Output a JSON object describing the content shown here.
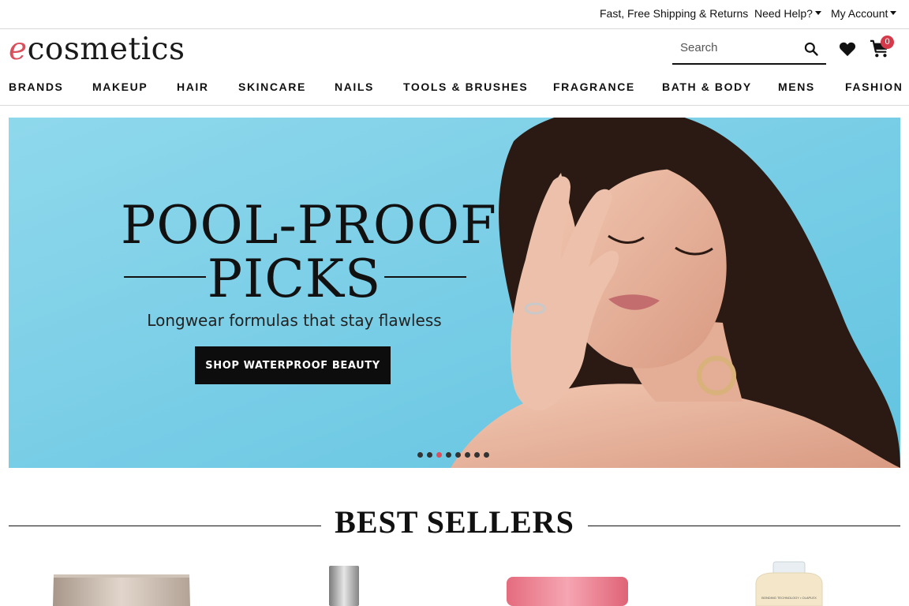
{
  "utility": {
    "shipping": "Fast, Free Shipping & Returns",
    "help": "Need Help?",
    "account": "My Account"
  },
  "header": {
    "logo_first": "e",
    "logo_rest": "cosmetics",
    "search_placeholder": "Search",
    "cart_count": "0"
  },
  "nav": {
    "items": [
      "BRANDS",
      "MAKEUP",
      "HAIR",
      "SKINCARE",
      "NAILS",
      "TOOLS & BRUSHES",
      "FRAGRANCE",
      "BATH & BODY",
      "MENS",
      "FASHION"
    ]
  },
  "hero": {
    "title_line1": "POOL-PROOF",
    "title_line2": "PICKS",
    "subtitle": "Longwear formulas that stay flawless",
    "cta": "SHOP WATERPROOF BEAUTY",
    "slide_count": 8,
    "active_slide": 3
  },
  "best_sellers": {
    "title": "BEST SELLERS",
    "product_label": "BONDING TECHNOLOGY • OLAPLEX"
  },
  "colors": {
    "accent": "#d94f5c",
    "hero_bg": "#7fd0e6",
    "cta_bg": "#0d0d0d"
  }
}
